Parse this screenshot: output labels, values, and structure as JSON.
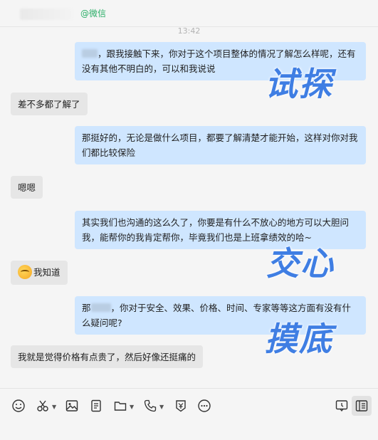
{
  "header": {
    "tag": "@微信"
  },
  "timestamp": "13:42",
  "messages": [
    {
      "side": "right",
      "text": "，跟我接触下来，你对于这个项目整体的情况了解怎么样呢，还有没有其他不明白的，可以和我说说"
    },
    {
      "side": "left",
      "text": "差不多都了解了"
    },
    {
      "side": "right",
      "text": "那挺好的，无论是做什么项目，都要了解清楚才能开始，这样对你对我们都比较保险"
    },
    {
      "side": "left",
      "text": "嗯嗯"
    },
    {
      "side": "right",
      "text": "其实我们也沟通的这么久了，你要是有什么不放心的地方可以大胆问我，能帮你的我肯定帮你，毕竟我们也是上班拿绩效的哈~"
    },
    {
      "side": "left",
      "text": "我知道"
    },
    {
      "side": "right",
      "prefix": "那",
      "text": "，你对于安全、效果、价格、时间、专家等等这方面有没有什么疑问呢?"
    },
    {
      "side": "left",
      "text": "我就是觉得价格有点贵了，然后好像还挺痛的"
    }
  ],
  "overlays": {
    "probe": "试探",
    "heart": "交心",
    "bottom": "摸底"
  },
  "toolbar": {
    "icons": [
      "emoji-icon",
      "scissors-icon",
      "image-icon",
      "document-icon",
      "folder-icon",
      "phone-icon",
      "red-packet-icon",
      "more-icon",
      "chat-history-icon",
      "sidebar-icon"
    ]
  },
  "colors": {
    "right_bubble": "#cfe6ff",
    "left_bubble": "#e6e6e6",
    "overlay_text": "#3f7ee3",
    "tag_green": "#2aae67"
  }
}
